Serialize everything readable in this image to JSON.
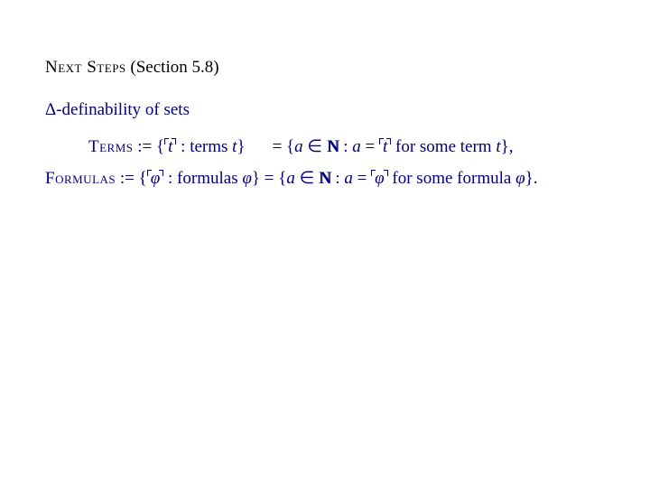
{
  "heading": {
    "smallcaps": "Next Steps",
    "rest": " (Section 5.8)"
  },
  "delta_line": {
    "delta": "Δ",
    "text": "-definability of sets"
  },
  "terms_def": {
    "label_sc": "Terms",
    "assign": " := {",
    "godel_var": "t",
    "mid1": " : terms ",
    "var1": "t",
    "close1": "}",
    "eq": "= {",
    "a": "a",
    "in": " ∈ ",
    "N": "N",
    "cond": " : ",
    "a2": "a",
    "eq2": " = ",
    "godel_var2": "t",
    "tail": " for some term ",
    "var2": "t",
    "close2": "},"
  },
  "formulas_def": {
    "label_sc": "Formulas",
    "assign": " := {",
    "godel_var": "φ",
    "mid1": " : formulas ",
    "var1": "φ",
    "close1": "} = {",
    "a": "a",
    "in": " ∈ ",
    "N": "N",
    "cond": " : ",
    "a2": "a",
    "eq2": " = ",
    "godel_var2": "φ",
    "tail": " for some formula ",
    "var2": "φ",
    "close2": "}."
  }
}
